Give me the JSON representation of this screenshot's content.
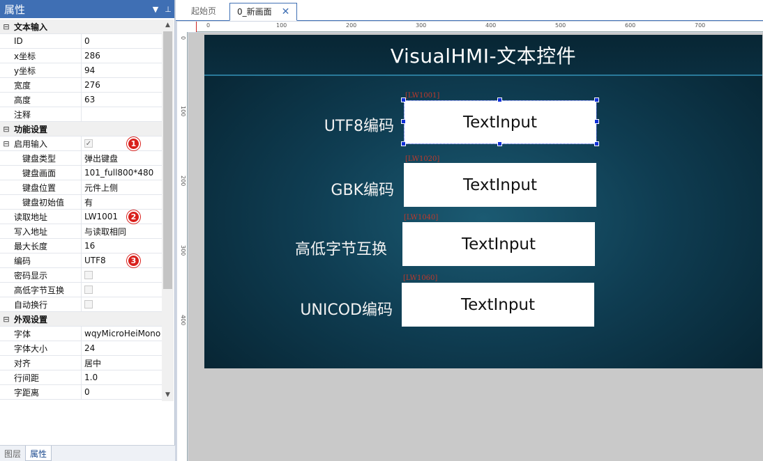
{
  "panel": {
    "title": "属性",
    "rows": [
      {
        "type": "cat",
        "label": "文本输入"
      },
      {
        "type": "prop",
        "key": "ID",
        "value": "0"
      },
      {
        "type": "prop",
        "key": "x坐标",
        "value": "286"
      },
      {
        "type": "prop",
        "key": "y坐标",
        "value": "94"
      },
      {
        "type": "prop",
        "key": "宽度",
        "value": "276"
      },
      {
        "type": "prop",
        "key": "高度",
        "value": "63"
      },
      {
        "type": "prop",
        "key": "注释",
        "value": ""
      },
      {
        "type": "cat",
        "label": "功能设置"
      },
      {
        "type": "prop",
        "key": "启用输入",
        "checkbox": true,
        "checked": true,
        "toggle": true
      },
      {
        "type": "sub",
        "key": "键盘类型",
        "value": "弹出键盘"
      },
      {
        "type": "sub",
        "key": "键盘画面",
        "value": "101_full800*480"
      },
      {
        "type": "sub",
        "key": "键盘位置",
        "value": "元件上侧"
      },
      {
        "type": "sub",
        "key": "键盘初始值",
        "value": "有"
      },
      {
        "type": "prop",
        "key": "读取地址",
        "value": "LW1001"
      },
      {
        "type": "prop",
        "key": "写入地址",
        "value": "与读取相同"
      },
      {
        "type": "prop",
        "key": "最大长度",
        "value": "16"
      },
      {
        "type": "prop",
        "key": "编码",
        "value": "UTF8"
      },
      {
        "type": "prop",
        "key": "密码显示",
        "checkbox": true,
        "checked": false
      },
      {
        "type": "prop",
        "key": "高低字节互换",
        "checkbox": true,
        "checked": false
      },
      {
        "type": "prop",
        "key": "自动换行",
        "checkbox": true,
        "checked": false
      },
      {
        "type": "cat",
        "label": "外观设置"
      },
      {
        "type": "prop",
        "key": "字体",
        "value": "wqyMicroHeiMono"
      },
      {
        "type": "prop",
        "key": "字体大小",
        "value": "24"
      },
      {
        "type": "prop",
        "key": "对齐",
        "value": "居中"
      },
      {
        "type": "prop",
        "key": "行间距",
        "value": "1.0"
      },
      {
        "type": "prop",
        "key": "字距离",
        "value": "0"
      }
    ],
    "badges": [
      "1",
      "2",
      "3"
    ],
    "bottom_tabs": [
      "图层",
      "属性"
    ]
  },
  "doc_tabs": {
    "start": "起始页",
    "current": "0_新画面"
  },
  "ruler": {
    "h_ticks": [
      "0",
      "100",
      "200",
      "300",
      "400",
      "500",
      "600",
      "700"
    ],
    "v_ticks": [
      "0",
      "100",
      "200",
      "300",
      "400"
    ]
  },
  "screen": {
    "title": "VisualHMI-文本控件",
    "controls": [
      {
        "label": "UTF8编码",
        "address": "[LW1001]",
        "text": "TextInput"
      },
      {
        "label": "GBK编码",
        "address": "[LW1020]",
        "text": "TextInput"
      },
      {
        "label": "高低字节互换",
        "address": "[LW1040]",
        "text": "TextInput"
      },
      {
        "label": "UNICOD编码",
        "address": "[LW1060]",
        "text": "TextInput"
      }
    ]
  },
  "colors": {
    "accent": "#3f6fb4",
    "badge": "#d9201c",
    "address_text": "#c0392b"
  }
}
